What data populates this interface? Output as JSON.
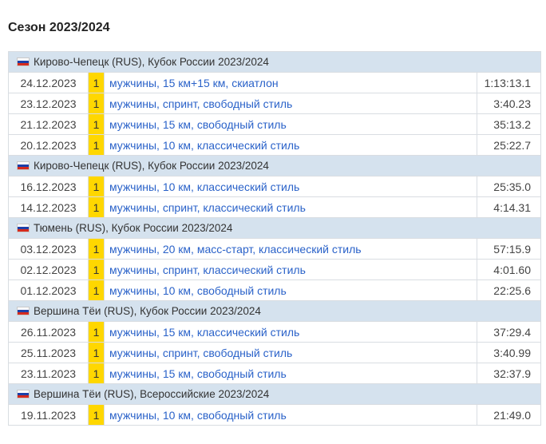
{
  "season_title": "Сезон 2023/2024",
  "groups": [
    {
      "flag": "russia-flag",
      "title": "Кирово-Чепецк (RUS), Кубок России 2023/2024",
      "results": [
        {
          "date": "24.12.2023",
          "place": "1",
          "event": "мужчины, 15 км+15 км, скиатлон",
          "time": "1:13:13.1"
        },
        {
          "date": "23.12.2023",
          "place": "1",
          "event": "мужчины, спринт, свободный стиль",
          "time": "3:40.23"
        },
        {
          "date": "21.12.2023",
          "place": "1",
          "event": "мужчины, 15 км, свободный стиль",
          "time": "35:13.2"
        },
        {
          "date": "20.12.2023",
          "place": "1",
          "event": "мужчины, 10 км, классический стиль",
          "time": "25:22.7"
        }
      ]
    },
    {
      "flag": "russia-flag",
      "title": "Кирово-Чепецк (RUS), Кубок России 2023/2024",
      "results": [
        {
          "date": "16.12.2023",
          "place": "1",
          "event": "мужчины, 10 км, классический стиль",
          "time": "25:35.0"
        },
        {
          "date": "14.12.2023",
          "place": "1",
          "event": "мужчины, спринт, классический стиль",
          "time": "4:14.31"
        }
      ]
    },
    {
      "flag": "russia-flag",
      "title": "Тюмень (RUS), Кубок России 2023/2024",
      "results": [
        {
          "date": "03.12.2023",
          "place": "1",
          "event": "мужчины, 20 км, масс-старт, классический стиль",
          "time": "57:15.9"
        },
        {
          "date": "02.12.2023",
          "place": "1",
          "event": "мужчины, спринт, классический стиль",
          "time": "4:01.60"
        },
        {
          "date": "01.12.2023",
          "place": "1",
          "event": "мужчины, 10 км, свободный стиль",
          "time": "22:25.6"
        }
      ]
    },
    {
      "flag": "russia-flag",
      "title": "Вершина Тёи (RUS), Кубок России 2023/2024",
      "results": [
        {
          "date": "26.11.2023",
          "place": "1",
          "event": "мужчины, 15 км, классический стиль",
          "time": "37:29.4"
        },
        {
          "date": "25.11.2023",
          "place": "1",
          "event": "мужчины, спринт, свободный стиль",
          "time": "3:40.99"
        },
        {
          "date": "23.11.2023",
          "place": "1",
          "event": "мужчины, 15 км, свободный стиль",
          "time": "32:37.9"
        }
      ]
    },
    {
      "flag": "russia-flag",
      "title": "Вершина Тёи (RUS), Всероссийские 2023/2024",
      "results": [
        {
          "date": "19.11.2023",
          "place": "1",
          "event": "мужчины, 10 км, свободный стиль",
          "time": "21:49.0"
        }
      ]
    }
  ],
  "colors": {
    "group_header_bg": "#d5e2ee",
    "gold_place": "#ffd700",
    "link": "#2a62c9",
    "border": "#d9dde2"
  }
}
